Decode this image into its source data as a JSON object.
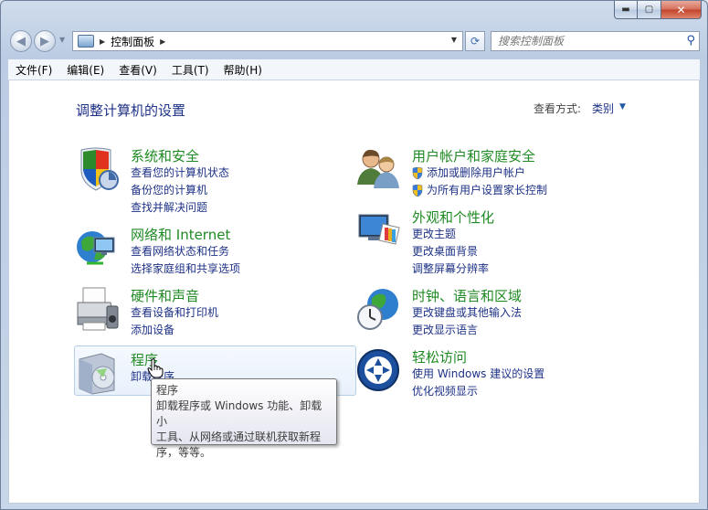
{
  "window": {
    "caption": {
      "minimize": "▬",
      "maximize": "▢",
      "close": "✕"
    }
  },
  "address": {
    "crumb": "控制面板",
    "search_placeholder": "搜索控制面板"
  },
  "menu": [
    "文件(F)",
    "编辑(E)",
    "查看(V)",
    "工具(T)",
    "帮助(H)"
  ],
  "content": {
    "title": "调整计算机的设置",
    "view_by_label": "查看方式:",
    "view_by_value": "类别"
  },
  "categories": {
    "system": {
      "title": "系统和安全",
      "links": [
        "查看您的计算机状态",
        "备份您的计算机",
        "查找并解决问题"
      ]
    },
    "network": {
      "title": "网络和 Internet",
      "links": [
        "查看网络状态和任务",
        "选择家庭组和共享选项"
      ]
    },
    "hardware": {
      "title": "硬件和声音",
      "links": [
        "查看设备和打印机",
        "添加设备"
      ]
    },
    "programs": {
      "title": "程序",
      "links": [
        "卸载程序"
      ]
    },
    "users": {
      "title": "用户帐户和家庭安全",
      "links": [
        "添加或删除用户帐户",
        "为所有用户设置家长控制"
      ]
    },
    "appearance": {
      "title": "外观和个性化",
      "links": [
        "更改主题",
        "更改桌面背景",
        "调整屏幕分辨率"
      ]
    },
    "clock": {
      "title": "时钟、语言和区域",
      "links": [
        "更改键盘或其他输入法",
        "更改显示语言"
      ]
    },
    "ease": {
      "title": "轻松访问",
      "links": [
        "使用 Windows 建议的设置",
        "优化视频显示"
      ]
    }
  },
  "tooltip": {
    "title": "程序",
    "line1": "卸载程序或 Windows 功能、卸载小",
    "line2": "工具、从网络或通过联机获取新程",
    "line3": "序，等等。"
  }
}
